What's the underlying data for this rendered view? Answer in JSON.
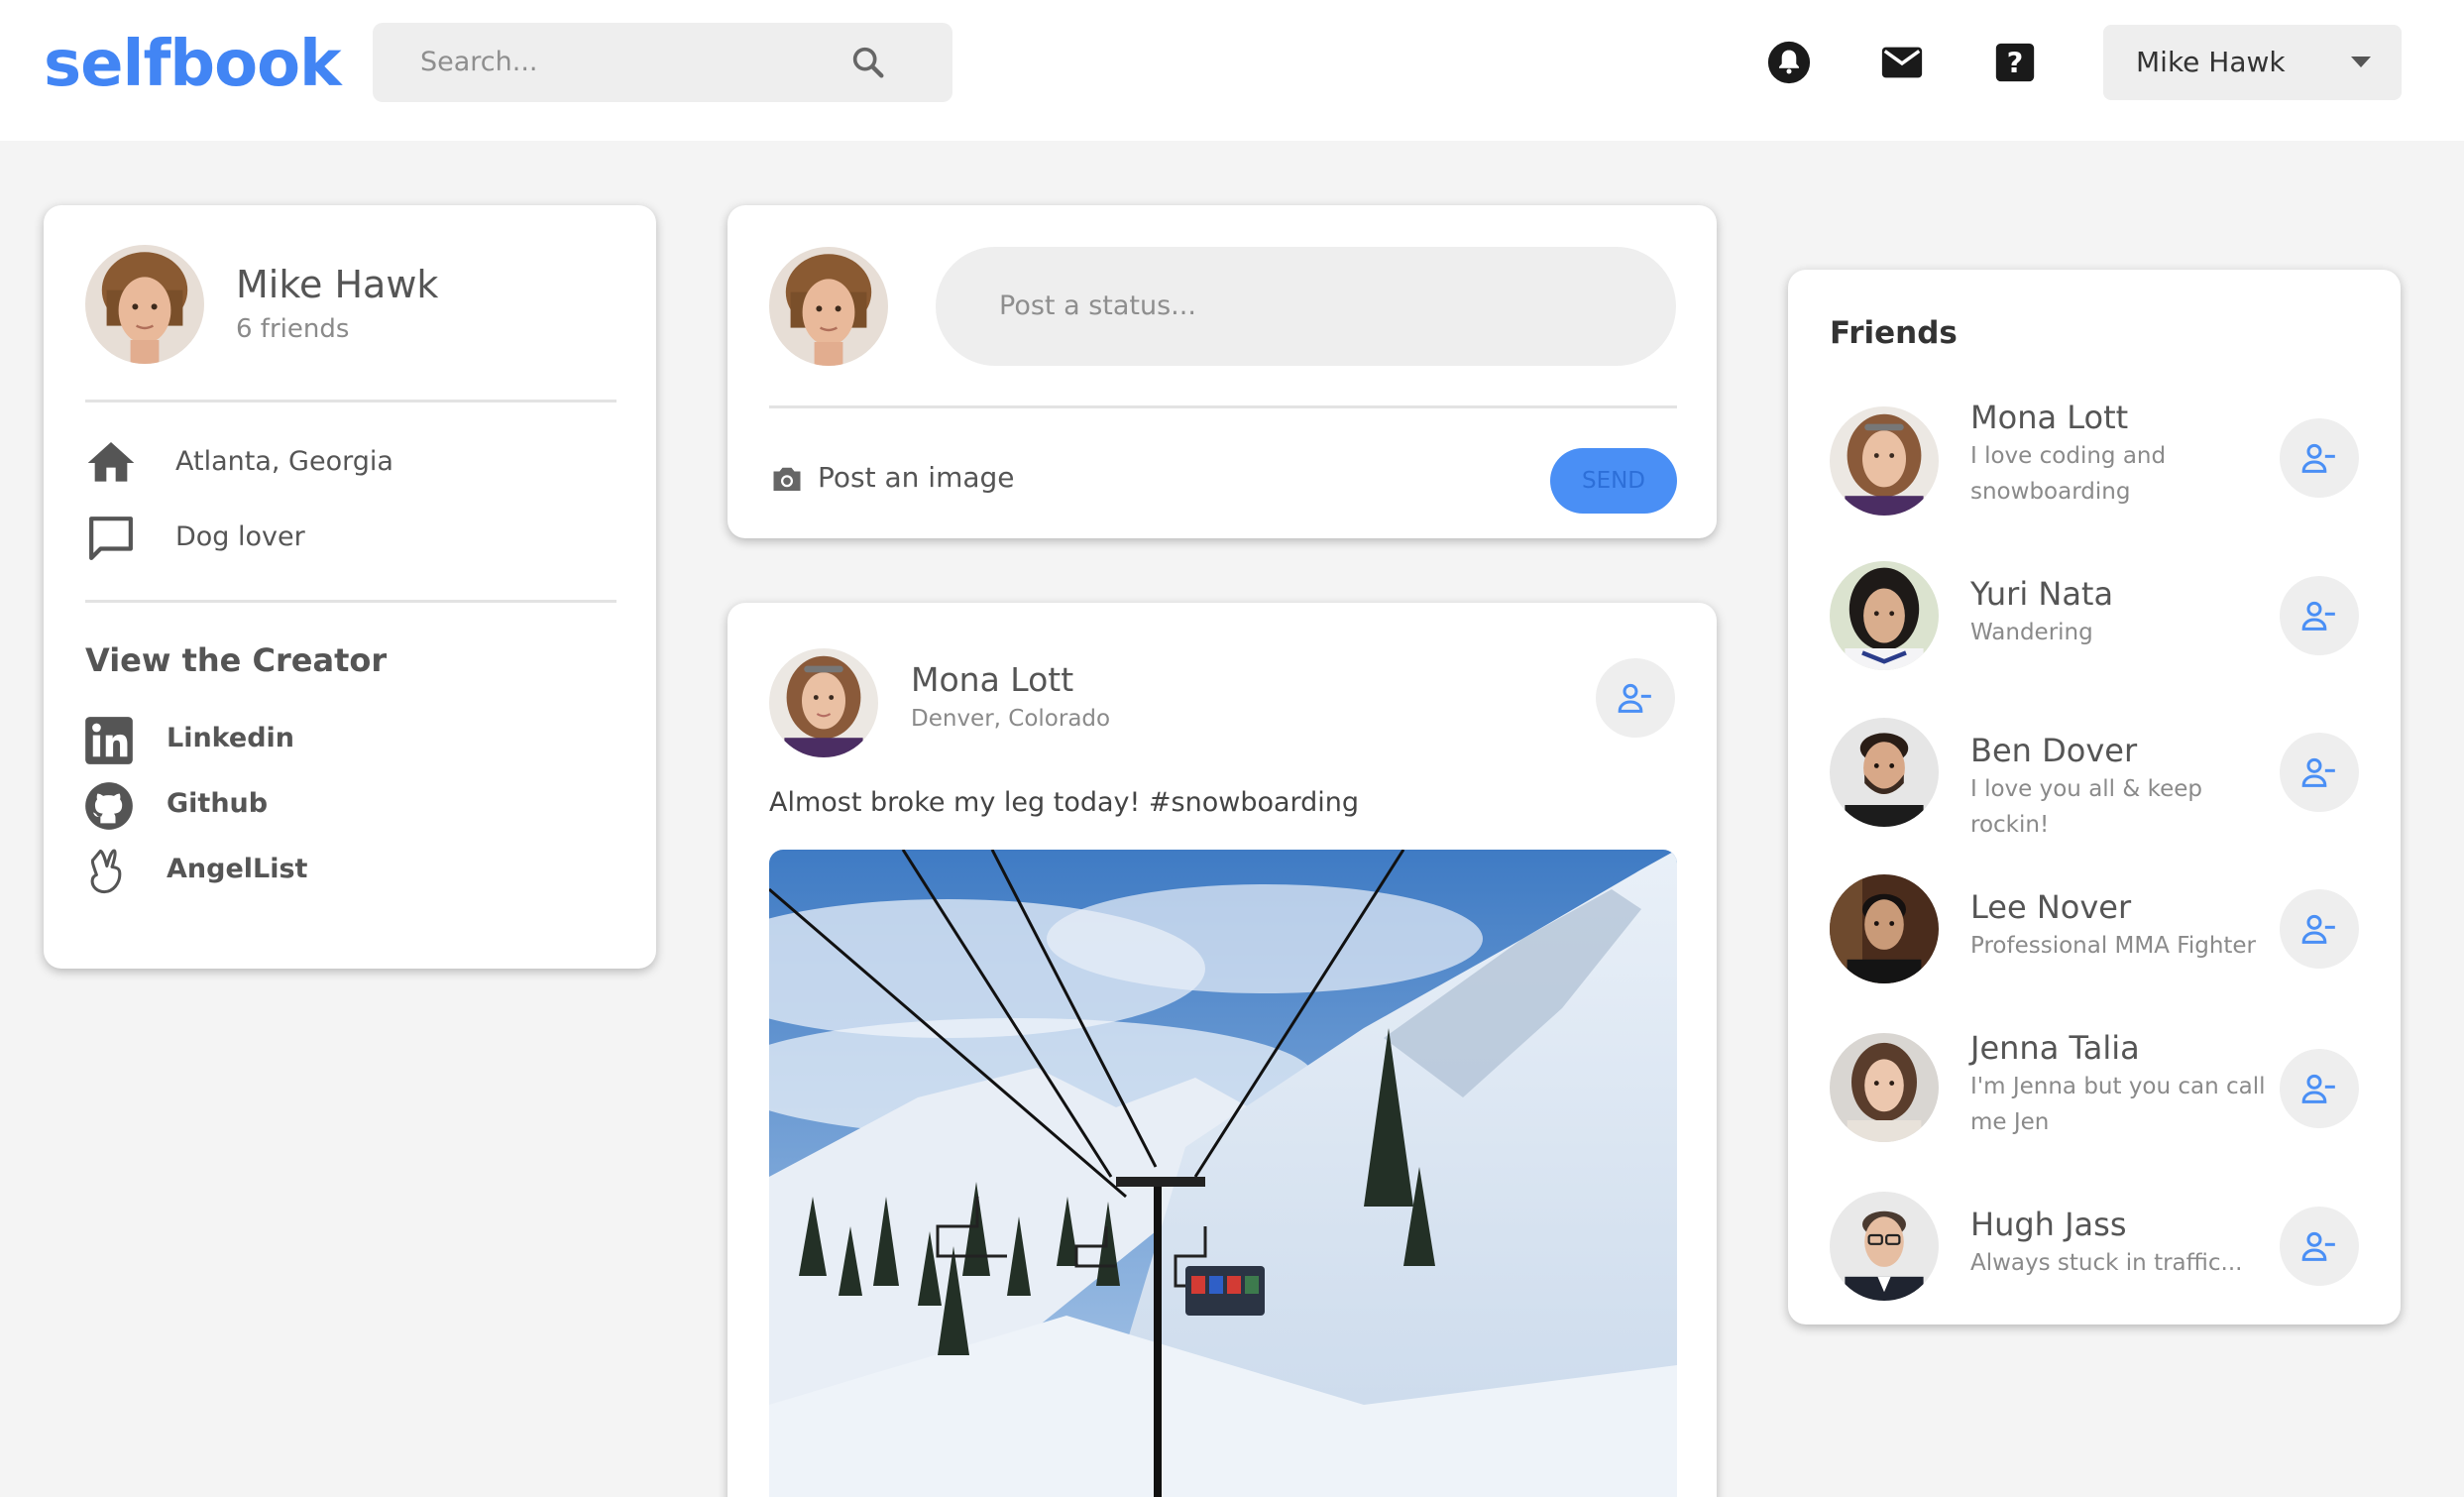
{
  "header": {
    "logo": "selfbook",
    "search_placeholder": "Search...",
    "user_menu_label": "Mike Hawk",
    "icons": [
      "bell-icon",
      "mail-icon",
      "help-icon"
    ],
    "brand_color": "#4285f4"
  },
  "profile": {
    "name": "Mike Hawk",
    "friends_count": "6 friends",
    "location": "Atlanta, Georgia",
    "bio": "Dog lover",
    "creator_heading": "View the Creator",
    "links": [
      {
        "label": "Linkedin",
        "icon": "linkedin-icon"
      },
      {
        "label": "Github",
        "icon": "github-icon"
      },
      {
        "label": "AngelList",
        "icon": "angellist-icon"
      }
    ]
  },
  "composer": {
    "placeholder": "Post a status...",
    "image_label": "Post an image",
    "send_label": "SEND"
  },
  "post": {
    "author": "Mona Lott",
    "location": "Denver, Colorado",
    "text": "Almost broke my leg today! #snowboarding",
    "image_alt": "ski lift over snowy mountain"
  },
  "friends": {
    "title": "Friends",
    "items": [
      {
        "name": "Mona Lott",
        "desc": "I love coding and snowboarding"
      },
      {
        "name": "Yuri Nata",
        "desc": "Wandering"
      },
      {
        "name": "Ben Dover",
        "desc": "I love you all & keep rockin!"
      },
      {
        "name": "Lee Nover",
        "desc": "Professional MMA Fighter"
      },
      {
        "name": "Jenna Talia",
        "desc": "I'm Jenna but you can call me Jen"
      },
      {
        "name": "Hugh Jass",
        "desc": "Always stuck in traffic..."
      }
    ]
  }
}
